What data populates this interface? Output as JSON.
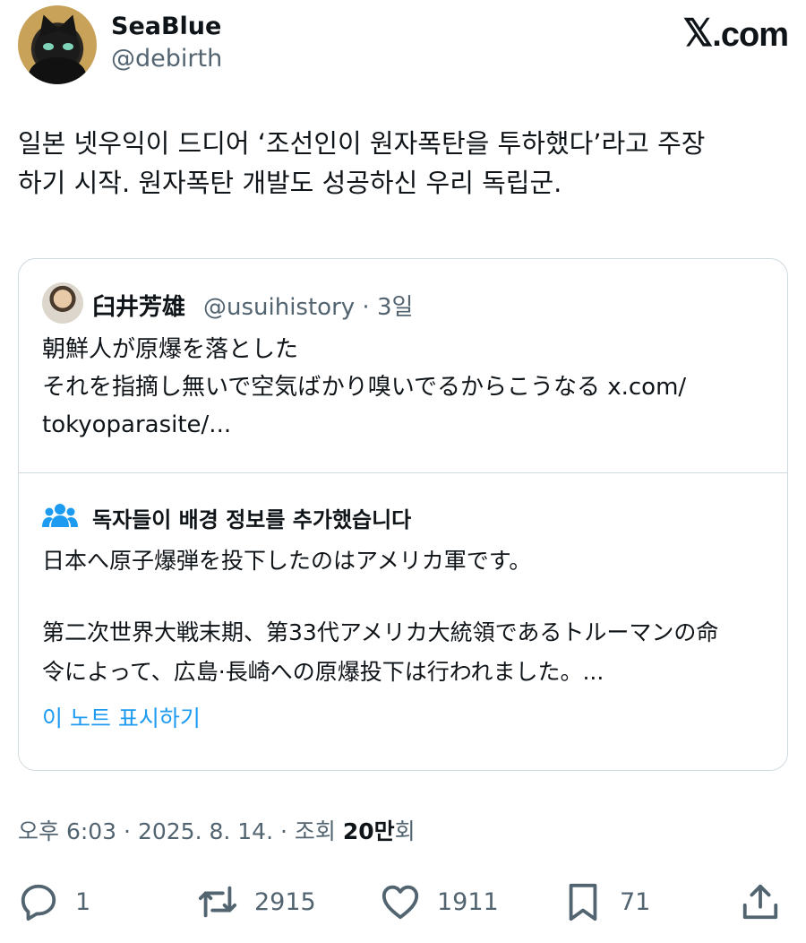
{
  "author": {
    "display_name": "SeaBlue",
    "handle": "@debirth",
    "avatar": "black-cat-avatar"
  },
  "brand": {
    "mark": "𝕏",
    "text": ".com"
  },
  "tweet": {
    "lines": [
      "일본 넷우익이 드디어 ‘조선인이 원자폭탄을 투하했다’라고 주장",
      "하기 시작. 원자폭탄 개발도 성공하신 우리 독립군."
    ]
  },
  "quote": {
    "author_name": "臼井芳雄",
    "handle_and_time": "@usuihistory · 3일",
    "lines": [
      "朝鮮人が原爆を落とした",
      "それを指摘し無いで空気ばかり嗅いでるからこうなる x.com/",
      "tokyoparasite/..."
    ]
  },
  "community_note": {
    "icon": "people-icon",
    "title": "독자들이 배경 정보를 추가했습니다",
    "paragraph1": "日本へ原子爆弾を投下したのはアメリカ軍です。",
    "paragraph2_lines": [
      "第二次世界大戦末期、第33代アメリカ大統領であるトルーマンの命",
      "令によって、広島·長崎への原爆投下は行われました。..."
    ],
    "show_link": "이 노트 표시하기"
  },
  "meta": {
    "time": "오후 6:03",
    "date": "2025. 8. 14.",
    "views_label": "조회",
    "views_count": "20만",
    "views_suffix": "회"
  },
  "actions": {
    "replies": "1",
    "reposts": "2915",
    "likes": "1911",
    "bookmarks": "71"
  },
  "colors": {
    "text": "#0f1419",
    "secondary": "#536471",
    "link": "#1d9bf0",
    "border": "#cfd9de",
    "note_icon": "#1d9bf0"
  }
}
